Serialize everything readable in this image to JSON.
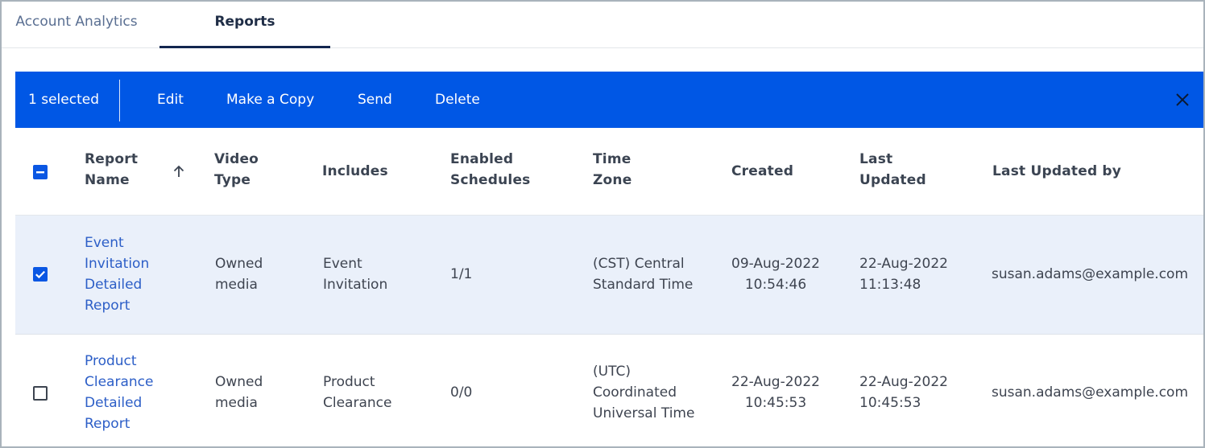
{
  "tabs": [
    {
      "label": "Account Analytics"
    },
    {
      "label": "Reports",
      "active": true
    }
  ],
  "toolbar": {
    "selected_count": "1 selected",
    "actions": {
      "edit": "Edit",
      "copy": "Make a Copy",
      "send": "Send",
      "delete": "Delete"
    },
    "close_icon": "close-icon",
    "background": "#0057e5"
  },
  "table": {
    "headers": {
      "report_name": [
        "Report",
        "Name"
      ],
      "video_type": [
        "Video",
        "Type"
      ],
      "includes": "Includes",
      "enabled_schedules": [
        "Enabled",
        "Schedules"
      ],
      "time_zone": [
        "Time",
        "Zone"
      ],
      "created": "Created",
      "last_updated": [
        "Last",
        "Updated"
      ],
      "last_updated_by": "Last Updated by"
    },
    "sort": {
      "column": "Report Name",
      "direction": "ascending",
      "icon": "arrow-up-icon"
    },
    "header_checkbox": "indeterminate",
    "rows": [
      {
        "selected": true,
        "report_name": [
          "Event",
          "Invitation",
          "Detailed",
          "Report"
        ],
        "video_type": [
          "Owned",
          "media"
        ],
        "includes": [
          "Event",
          "Invitation"
        ],
        "enabled_schedules": "1/1",
        "time_zone": [
          "(CST) Central",
          "Standard Time"
        ],
        "created": [
          "09-Aug-2022",
          "10:54:46"
        ],
        "last_updated": [
          "22-Aug-2022",
          "11:13:48"
        ],
        "last_updated_by": "susan.adams@example.com"
      },
      {
        "selected": false,
        "report_name": [
          "Product",
          "Clearance",
          "Detailed",
          "Report"
        ],
        "video_type": [
          "Owned",
          "media"
        ],
        "includes": [
          "Product",
          "Clearance"
        ],
        "enabled_schedules": "0/0",
        "time_zone": [
          "(UTC)",
          "Coordinated",
          "Universal Time"
        ],
        "created": [
          "22-Aug-2022",
          "10:45:53"
        ],
        "last_updated": [
          "22-Aug-2022",
          "10:45:53"
        ],
        "last_updated_by": "susan.adams@example.com"
      }
    ]
  },
  "colors": {
    "accent": "#0057e5",
    "selected_row": "#eaf0fa",
    "link": "#2c5ec7"
  }
}
